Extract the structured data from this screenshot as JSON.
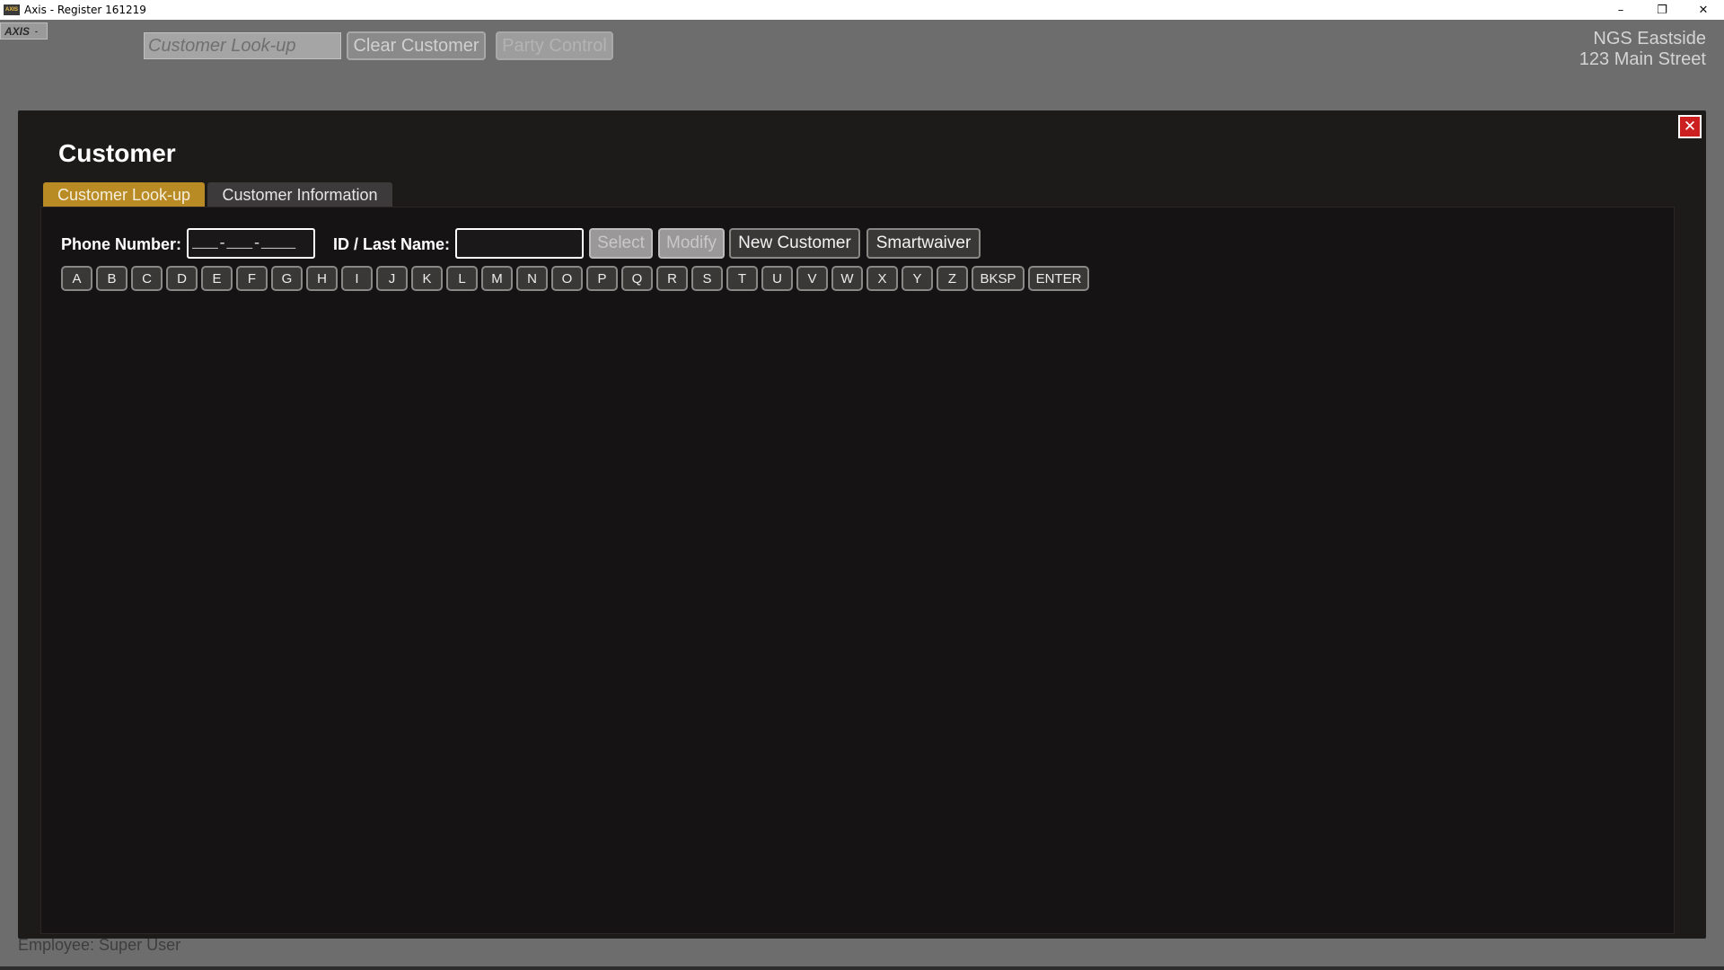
{
  "window": {
    "title": "Axis - Register  161219",
    "logo_text": "AXIS",
    "controls": [
      "–",
      "❐",
      "✕"
    ]
  },
  "topbar": {
    "axis_badge": "AXIS",
    "axis_caret": "-",
    "lookup_placeholder": "Customer Look-up",
    "clear_customer": "Clear Customer",
    "party_control": "Party Control",
    "location_name": "NGS Eastside",
    "location_address": "123 Main Street"
  },
  "background": {
    "employee_text": "Employee: Super User"
  },
  "modal": {
    "title": "Customer",
    "close_glyph": "✕",
    "tabs": [
      {
        "label": "Customer Look-up",
        "active": true
      },
      {
        "label": "Customer Information",
        "active": false
      }
    ],
    "phone_label": "Phone Number:",
    "phone_mask": "___-___-____",
    "id_label": "ID / Last Name:",
    "id_value": "",
    "buttons": {
      "select": "Select",
      "modify": "Modify",
      "new_customer": "New Customer",
      "smartwaiver": "Smartwaiver"
    },
    "keys": [
      "A",
      "B",
      "C",
      "D",
      "E",
      "F",
      "G",
      "H",
      "I",
      "J",
      "K",
      "L",
      "M",
      "N",
      "O",
      "P",
      "Q",
      "R",
      "S",
      "T",
      "U",
      "V",
      "W",
      "X",
      "Y",
      "Z",
      "BKSP",
      "ENTER"
    ]
  },
  "colors": {
    "active_tab": "#b98b25",
    "close_button": "#cc1f1f",
    "modal_bg": "#1d1a1a"
  }
}
